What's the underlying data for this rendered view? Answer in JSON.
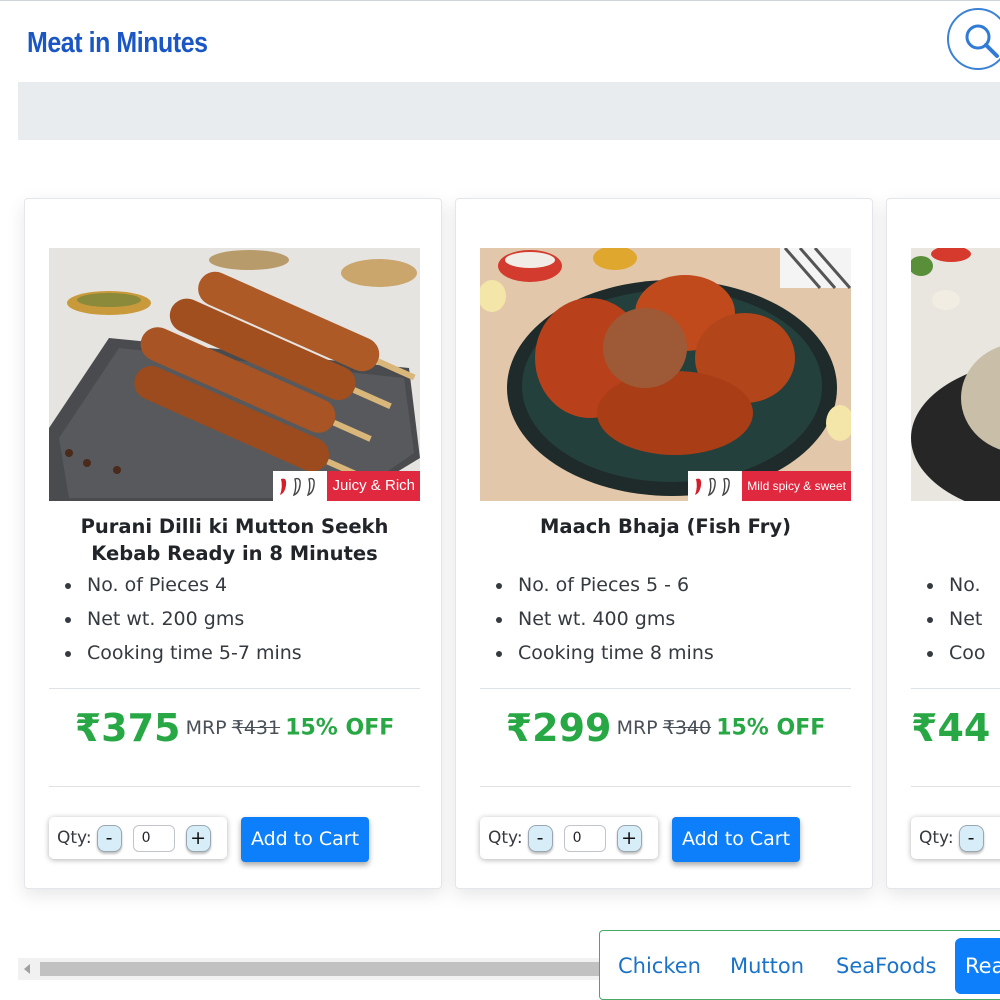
{
  "header": {
    "logo_text": "Meat in Minutes",
    "search_icon": "search-icon"
  },
  "products": [
    {
      "title": "Purani Dilli ki Mutton Seekh Kebab Ready in 8 Minutes",
      "tag": "Juicy & Rich",
      "details": [
        "No. of Pieces 4",
        "Net wt. 200 gms",
        "Cooking time 5-7 mins"
      ],
      "price": "₹375",
      "mrp_label": "MRP",
      "mrp": "₹431",
      "discount": "15% OFF",
      "qty_label": "Qty:",
      "qty_value": "0",
      "minus_label": "-",
      "plus_label": "+",
      "add_label": "Add to Cart"
    },
    {
      "title": "Maach Bhaja (Fish Fry)",
      "tag": "Mild spicy & sweet",
      "details": [
        "No. of Pieces 5 - 6",
        "Net wt. 400 gms",
        "Cooking time 8 mins"
      ],
      "price": "₹299",
      "mrp_label": "MRP",
      "mrp": "₹340",
      "discount": "15% OFF",
      "qty_label": "Qty:",
      "qty_value": "0",
      "minus_label": "-",
      "plus_label": "+",
      "add_label": "Add to Cart"
    },
    {
      "details": [
        "No.",
        "Net",
        "Coo"
      ],
      "price": "₹44",
      "qty_label": "Qty:",
      "minus_label": "-"
    }
  ],
  "categories": [
    "Chicken",
    "Mutton",
    "SeaFoods",
    "Rea"
  ],
  "colors": {
    "brand": "#1a56c4",
    "price_green": "#28a745",
    "primary_button": "#0d7ffb",
    "tag_red": "#e0283e",
    "category_link": "#1a73c9"
  }
}
